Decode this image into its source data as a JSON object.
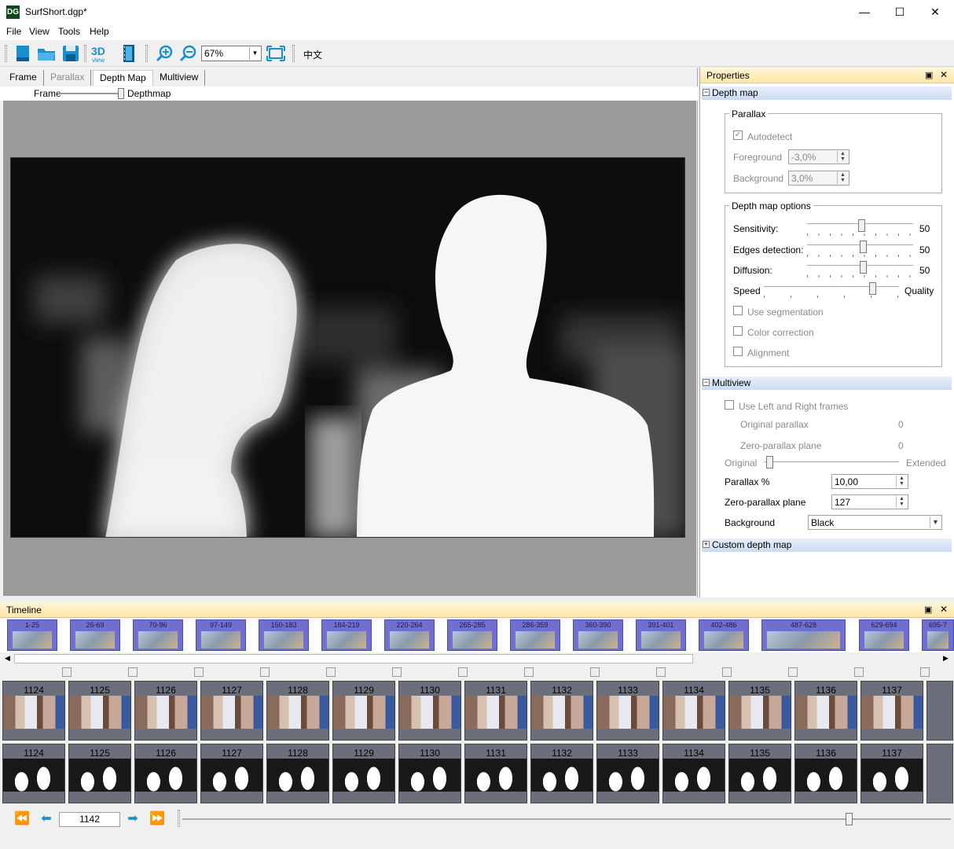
{
  "window": {
    "title": "SurfShort.dgp*",
    "app_icon_text": "DG",
    "minimize": "—",
    "maximize": "☐",
    "close": "✕"
  },
  "menu": [
    "File",
    "View",
    "Tools",
    "Help"
  ],
  "toolbar": {
    "zoom_value": "67%",
    "language_label": "中文",
    "view3d_label": "3D view"
  },
  "tabs": [
    {
      "label": "Frame",
      "state": "normal"
    },
    {
      "label": "Parallax",
      "state": "disabled"
    },
    {
      "label": "Depth Map",
      "state": "active"
    },
    {
      "label": "Multiview",
      "state": "normal"
    }
  ],
  "view_slider": {
    "left_label": "Frame",
    "right_label": "Depthmap"
  },
  "properties": {
    "title": "Properties",
    "depth_map_section": "Depth map",
    "parallax_group": "Parallax",
    "autodetect_label": "Autodetect",
    "autodetect_checked": true,
    "foreground_label": "Foreground",
    "foreground_value": "-3,0%",
    "background_label": "Background",
    "background_value": "3,0%",
    "options_group": "Depth map options",
    "sensitivity_label": "Sensitivity:",
    "sensitivity_value": "50",
    "edges_label": "Edges detection:",
    "edges_value": "50",
    "diffusion_label": "Diffusion:",
    "diffusion_value": "50",
    "speed_label": "Speed",
    "quality_label": "Quality",
    "use_segmentation": "Use segmentation",
    "color_correction": "Color correction",
    "alignment": "Alignment",
    "multiview_section": "Multiview",
    "use_lr_frames": "Use Left and Right frames",
    "original_parallax_label": "Original parallax",
    "original_parallax_value": "0",
    "zero_parallax_label": "Zero-parallax plane",
    "zero_parallax_value": "0",
    "original_label": "Original",
    "extended_label": "Extended",
    "parallax_pct_label": "Parallax %",
    "parallax_pct_value": "10,00",
    "zero_parallax_plane_label": "Zero-parallax plane",
    "zero_parallax_plane_value": "127",
    "background_select_label": "Background",
    "background_select_value": "Black",
    "custom_depth_section": "Custom depth map"
  },
  "timeline": {
    "title": "Timeline",
    "clips": [
      "1-25",
      "26-69",
      "70-96",
      "97-149",
      "150-183",
      "184-219",
      "220-264",
      "265-285",
      "286-359",
      "360-390",
      "391-401",
      "402-486",
      "487-628",
      "629-694",
      "695-7"
    ],
    "frames": [
      "1124",
      "1125",
      "1126",
      "1127",
      "1128",
      "1129",
      "1130",
      "1131",
      "1132",
      "1133",
      "1134",
      "1135",
      "1136",
      "1137"
    ],
    "current_frame": "1142"
  }
}
